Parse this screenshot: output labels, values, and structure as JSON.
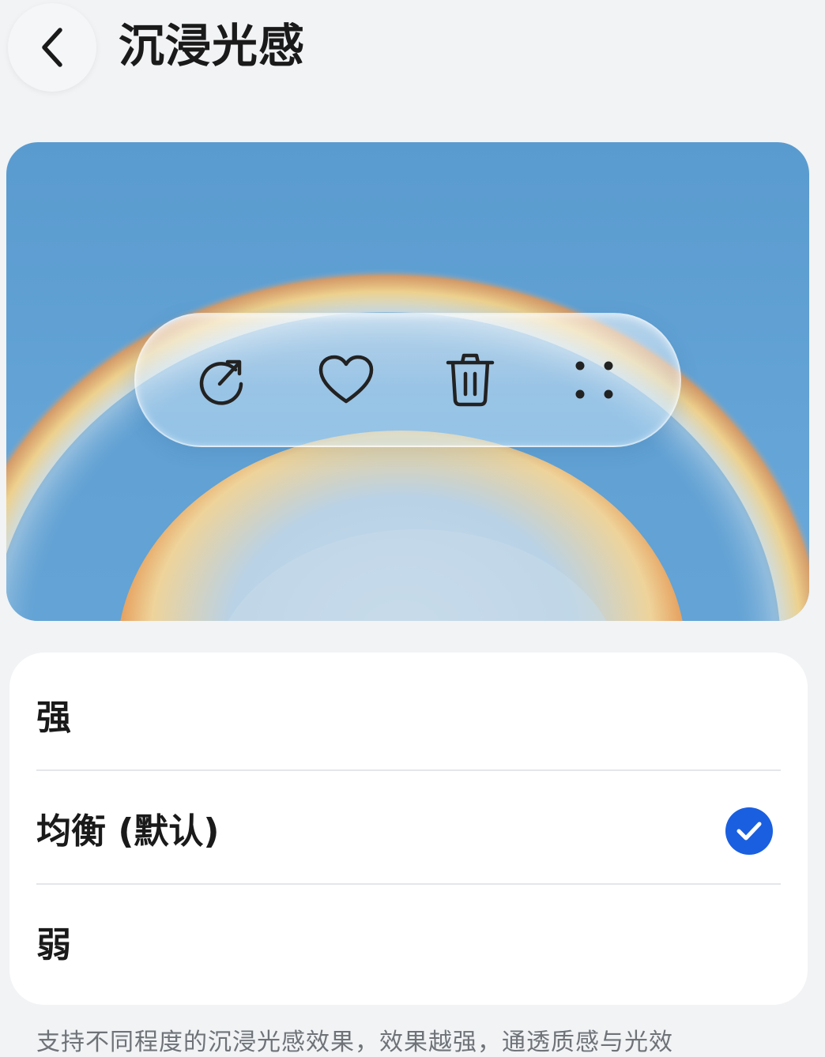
{
  "header": {
    "title": "沉浸光感",
    "back_icon": "chevron-left-icon"
  },
  "preview": {
    "toolbar_icons": [
      "share-icon",
      "heart-icon",
      "trash-icon",
      "more-dots-icon"
    ],
    "colors": {
      "sky": "#5fa0d2",
      "glow_yellow": "#f2cd76",
      "glow_orange": "#e79a58"
    }
  },
  "options": {
    "strong_label": "强",
    "balanced_label": "均衡 (默认)",
    "weak_label": "弱",
    "selected": "均衡 (默认)"
  },
  "footer": {
    "description": "支持不同程度的沉浸光感效果，效果越强，通透质感与光效"
  },
  "colors": {
    "accent": "#1a5fe0",
    "background": "#f1f3f5",
    "card": "#ffffff"
  }
}
